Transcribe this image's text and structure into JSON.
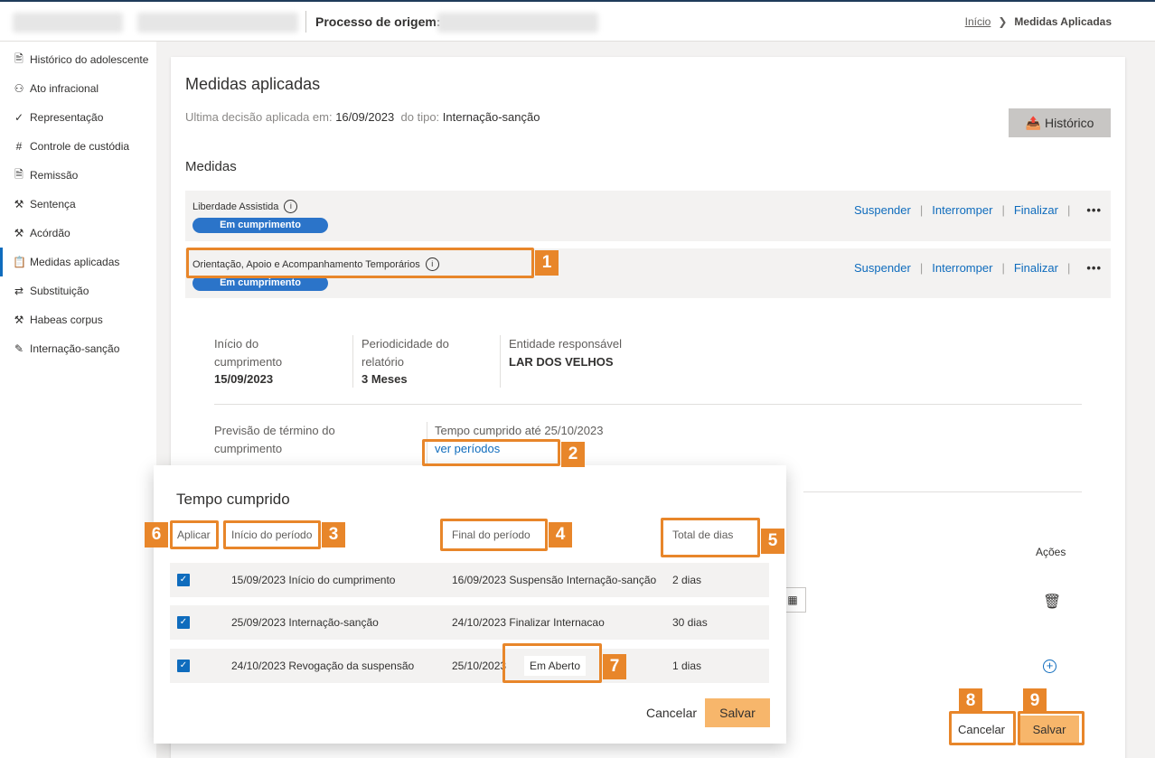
{
  "header": {
    "origin_label": "Processo de origem:",
    "breadcrumb_home": "Início",
    "breadcrumb_current": "Medidas Aplicadas"
  },
  "sidebar": {
    "items": [
      {
        "label": "Histórico do adolescente",
        "icon": "document-icon"
      },
      {
        "label": "Ato infracional",
        "icon": "person-icon"
      },
      {
        "label": "Representação",
        "icon": "checkmark-icon"
      },
      {
        "label": "Controle de custódia",
        "icon": "grid-icon"
      },
      {
        "label": "Remissão",
        "icon": "document-search-icon"
      },
      {
        "label": "Sentença",
        "icon": "gavel-icon"
      },
      {
        "label": "Acórdão",
        "icon": "gavel-icon"
      },
      {
        "label": "Medidas aplicadas",
        "icon": "clipboard-icon"
      },
      {
        "label": "Substituição",
        "icon": "swap-icon"
      },
      {
        "label": "Habeas corpus",
        "icon": "gavel-icon"
      },
      {
        "label": "Internação-sanção",
        "icon": "edit-document-icon"
      }
    ]
  },
  "main": {
    "title": "Medidas aplicadas",
    "last_decision_label": "Ultima decisão aplicada em:",
    "last_decision_date": "16/09/2023",
    "type_label": "do tipo:",
    "type_value": "Internação-sanção",
    "historico_button": "Histórico",
    "medidas_heading": "Medidas",
    "medidas": [
      {
        "name": "Liberdade Assistida",
        "status": "Em cumprimento"
      },
      {
        "name": "Orientação, Apoio e Acompanhamento Temporários",
        "status": "Em cumprimento"
      }
    ],
    "actions": {
      "suspend": "Suspender",
      "interrupt": "Interromper",
      "finalize": "Finalizar",
      "more": "•••"
    },
    "details": {
      "inicio_label": "Início do cumprimento",
      "inicio_value": "15/09/2023",
      "periodicidade_label": "Periodicidade do relatório",
      "periodicidade_value": "3 Meses",
      "entidade_label": "Entidade responsável",
      "entidade_value": "LAR DOS VELHOS",
      "previsao_label": "Previsão de término do cumprimento",
      "tempo_label": "Tempo cumprido até 25/10/2023",
      "ver_periodos": "ver períodos"
    },
    "acoes_heading": "Ações",
    "cancel_button": "Cancelar",
    "save_button": "Salvar"
  },
  "modal": {
    "title": "Tempo cumprido",
    "columns": {
      "apply": "Aplicar",
      "start": "Início do período",
      "end": "Final do período",
      "total": "Total de dias"
    },
    "rows": [
      {
        "start": "15/09/2023 Início do cumprimento",
        "end": "16/09/2023 Suspensão Internação-sanção",
        "total": "2 dias"
      },
      {
        "start": "25/09/2023 Internação-sanção",
        "end": "24/10/2023 Finalizar Internacao",
        "total": "30 dias"
      },
      {
        "start": "24/10/2023 Revogação da suspensão",
        "end": "25/10/2023",
        "end_note": "Em Aberto",
        "total": "1 dias"
      }
    ],
    "cancel_button": "Cancelar",
    "save_button": "Salvar"
  },
  "annotations": {
    "n1": "1",
    "n2": "2",
    "n3": "3",
    "n4": "4",
    "n5": "5",
    "n6": "6",
    "n7": "7",
    "n8": "8",
    "n9": "9"
  },
  "colors": {
    "accent": "#0f6cbd",
    "badge": "#2b74c9",
    "annotation": "#e8862a",
    "save": "#f7b66b"
  }
}
